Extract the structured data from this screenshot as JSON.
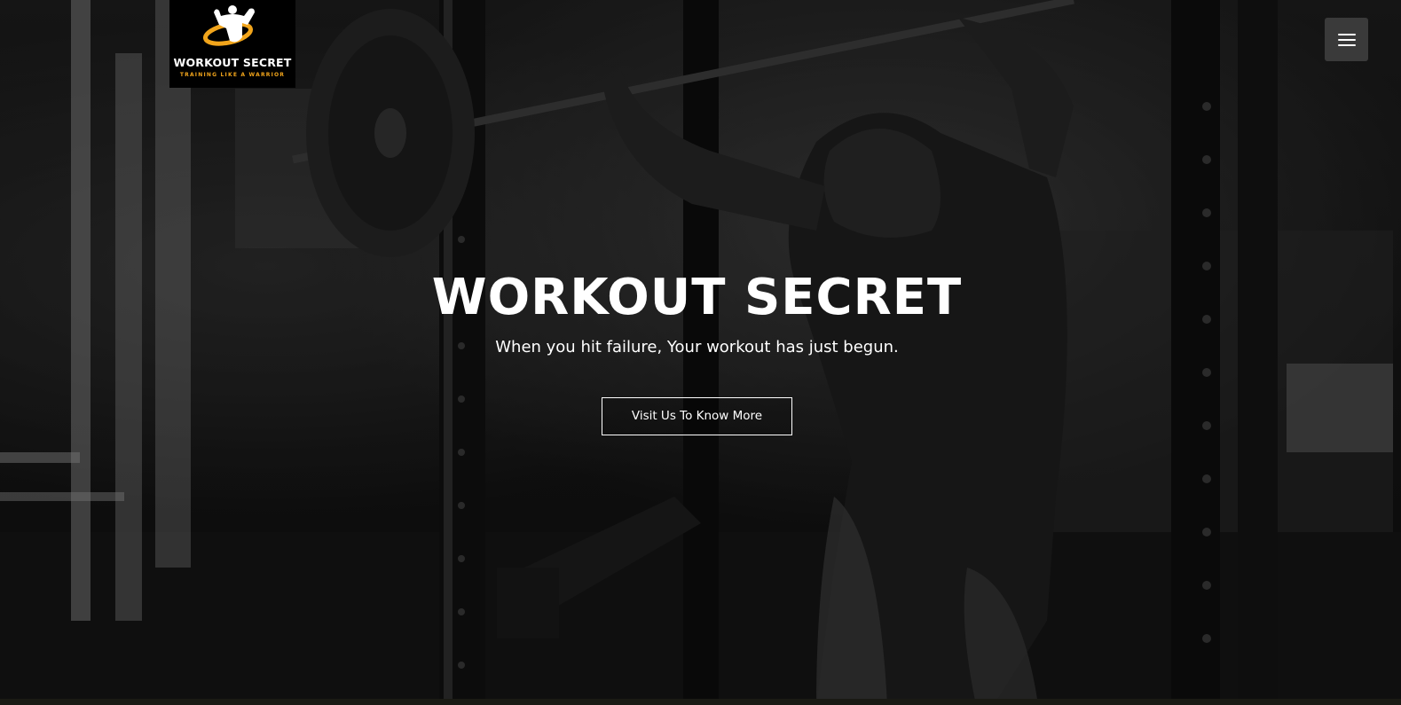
{
  "logo": {
    "title": "WORKOUT SECRET",
    "tagline": "TRAINING LIKE A WARRIOR",
    "accent_color": "#f2a51b"
  },
  "nav": {
    "menu_icon": "hamburger-menu-icon"
  },
  "hero": {
    "title": "WORKOUT SECRET",
    "subtitle": "When you hit failure, Your workout has just begun.",
    "cta_label": "Visit Us To Know More",
    "background_image": "dark grayscale gym photo of a hooded athlete lifting a loaded barbell in a power rack"
  }
}
